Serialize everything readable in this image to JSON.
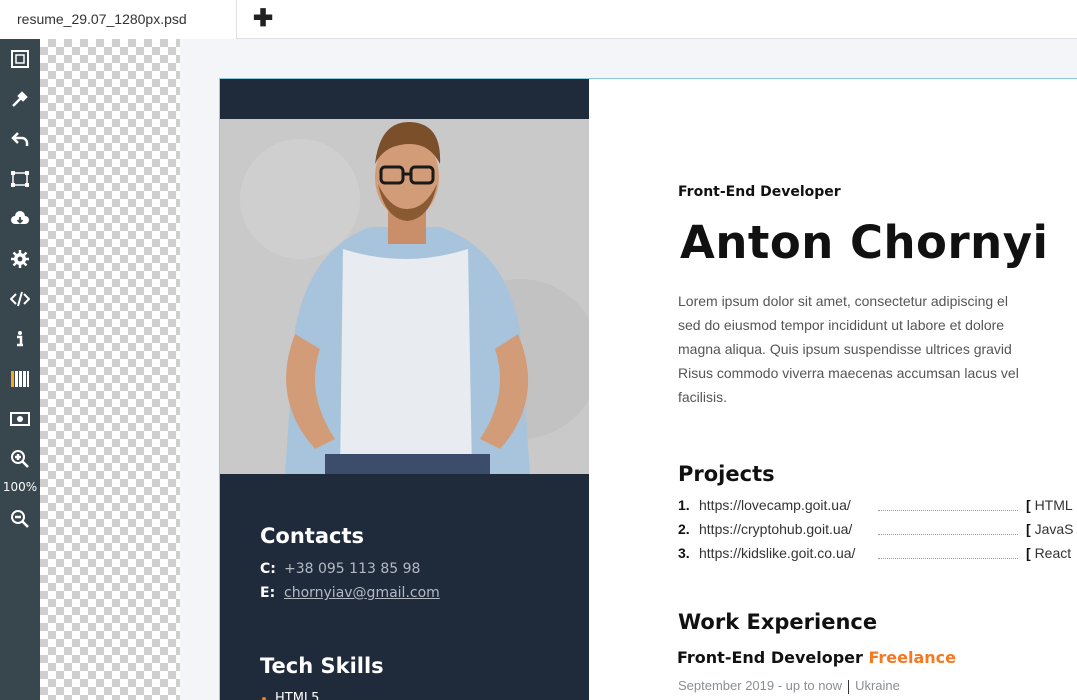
{
  "tabbar": {
    "tab_label": "resume_29.07_1280px.psd",
    "add_tab_icon": "plus-icon"
  },
  "toolbar": {
    "tools": [
      "crop-frame-icon",
      "eyedropper-icon",
      "undo-icon",
      "transform-icon",
      "download-cloud-icon",
      "settings-gear-icon",
      "code-icon",
      "info-icon",
      "layers-stripes-icon",
      "money-icon",
      "zoom-in-icon",
      "zoom-out-icon"
    ],
    "zoom_label": "100%"
  },
  "resume": {
    "contacts_title": "Contacts",
    "contacts": [
      {
        "key": "C:",
        "value": "+38 095 113 85 98"
      },
      {
        "key": "E:",
        "value": "chornyiav@gmail.com"
      }
    ],
    "tech_skills_title": "Tech Skills",
    "first_skill": "HTML5",
    "role": "Front-End Developer",
    "name": "Anton Chornyi",
    "about_lines": [
      "Lorem ipsum dolor sit amet, consectetur adipiscing el",
      "sed do eiusmod tempor incididunt ut labore et dolore",
      "magna aliqua. Quis ipsum suspendisse ultrices gravid",
      "Risus commodo viverra maecenas accumsan lacus vel",
      "facilisis."
    ],
    "projects_title": "Projects",
    "projects": [
      {
        "num": "1.",
        "url": "https://lovecamp.goit.ua/",
        "tech": "HTML"
      },
      {
        "num": "2.",
        "url": "https://cryptohub.goit.ua/",
        "tech": "JavaS"
      },
      {
        "num": "3.",
        "url": "https://kidslike.goit.co.ua/",
        "tech": "React"
      }
    ],
    "work_title": "Work Experience",
    "job_title": "Front-End Developer",
    "job_company": "Freelance",
    "job_period": "September 2019 - up to now",
    "job_location": "Ukraine"
  },
  "colors": {
    "sidebar_bg": "#1f2a3a",
    "accent": "#f47922",
    "toolbar_bg": "#38464d"
  }
}
